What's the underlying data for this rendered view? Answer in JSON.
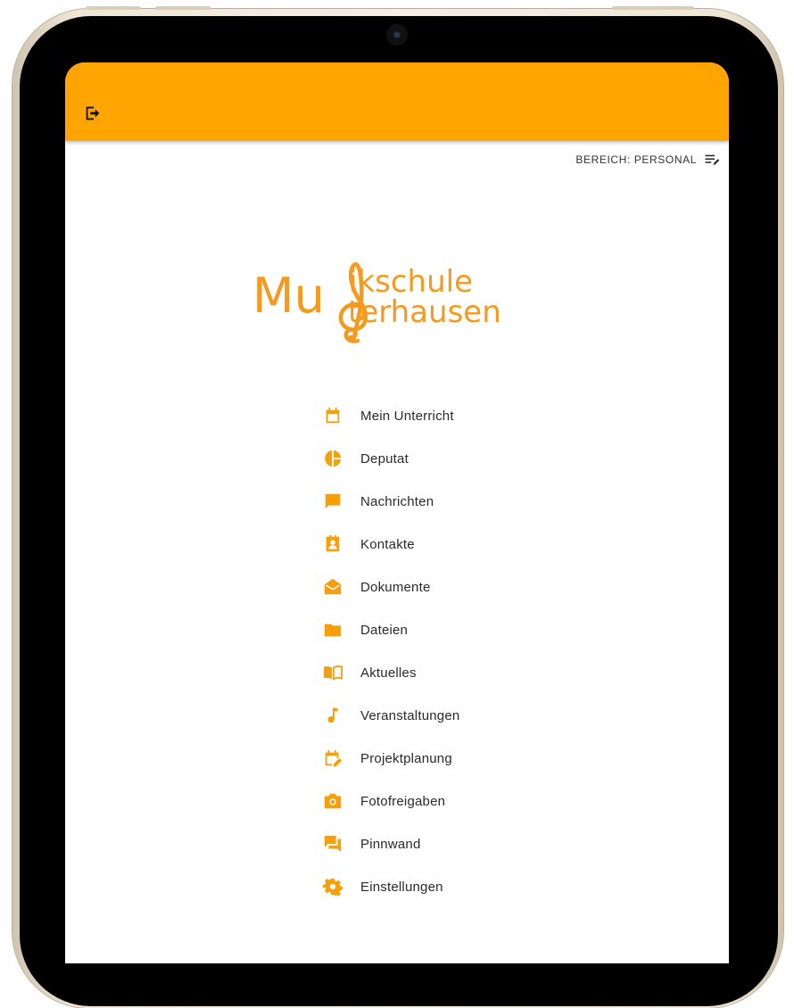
{
  "header": {
    "logout_icon": "logout-icon",
    "area_label": "BEREICH: PERSONAL",
    "area_icon": "edit-list-icon"
  },
  "logo": {
    "line_mu": "Mu",
    "line_top": "ikschule",
    "line_bottom": "terhausen",
    "color": "#f39a1f"
  },
  "colors": {
    "accent": "#ffa400",
    "icon": "#f5a00a"
  },
  "menu": {
    "items": [
      {
        "label": "Mein Unterricht",
        "icon": "calendar-icon"
      },
      {
        "label": "Deputat",
        "icon": "pie-chart-icon"
      },
      {
        "label": "Nachrichten",
        "icon": "chat-bubble-icon"
      },
      {
        "label": "Kontakte",
        "icon": "contact-card-icon"
      },
      {
        "label": "Dokumente",
        "icon": "envelope-open-icon"
      },
      {
        "label": "Dateien",
        "icon": "folder-icon"
      },
      {
        "label": "Aktuelles",
        "icon": "book-icon"
      },
      {
        "label": "Veranstaltungen",
        "icon": "music-note-icon"
      },
      {
        "label": "Projektplanung",
        "icon": "calendar-edit-icon"
      },
      {
        "label": "Fotofreigaben",
        "icon": "camera-icon"
      },
      {
        "label": "Pinnwand",
        "icon": "forum-icon"
      },
      {
        "label": "Einstellungen",
        "icon": "gear-icon"
      }
    ]
  }
}
